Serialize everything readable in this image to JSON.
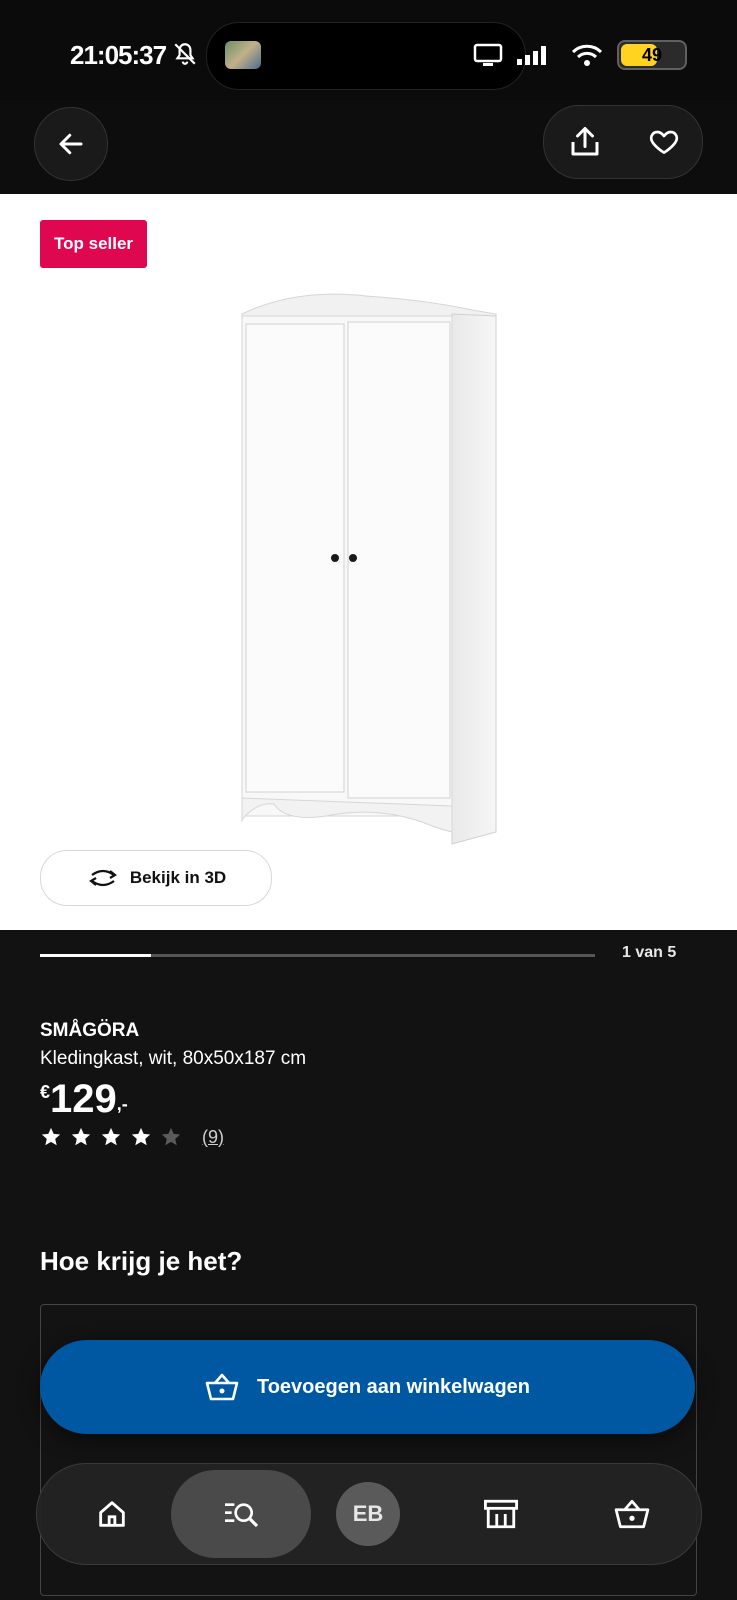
{
  "status_bar": {
    "time": "21:05:37",
    "battery": "49"
  },
  "header": {
    "back_icon": "arrow-left-icon",
    "share_icon": "share-icon",
    "favorite_icon": "heart-icon"
  },
  "image": {
    "badge": "Top seller",
    "view_3d_label": "Bekijk in 3D",
    "badge_color": "#e00751"
  },
  "carousel": {
    "position_text": "1 van 5",
    "progress_fraction": 0.2
  },
  "product": {
    "name": "SMÅGÖRA",
    "description": "Kledingkast, wit, 80x50x187 cm",
    "price_currency": "€",
    "price_integer": "129",
    "price_decimal": ",-",
    "rating": 4,
    "rating_max": 5,
    "review_count": "(9)"
  },
  "delivery": {
    "heading": "Hoe krijg je het?"
  },
  "cart": {
    "add_label": "Toevoegen aan winkelwagen",
    "button_color": "#0058a3"
  },
  "bottom_nav": {
    "items": [
      {
        "icon": "home-icon"
      },
      {
        "icon": "search-icon"
      },
      {
        "initials": "EB"
      },
      {
        "icon": "store-icon"
      },
      {
        "icon": "cart-icon"
      }
    ]
  }
}
